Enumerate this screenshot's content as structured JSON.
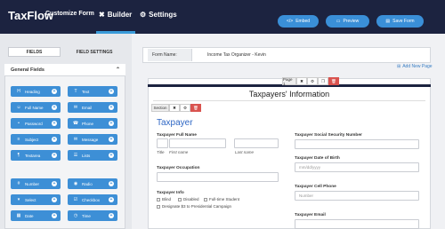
{
  "app": {
    "name": "TaxFlow",
    "subtitle": "Customize Form"
  },
  "nav": {
    "builder": "Builder",
    "settings": "Settings"
  },
  "actions": {
    "embed": "Embed",
    "preview": "Preview",
    "save": "Save Form"
  },
  "left_panel": {
    "tab_fields": "FIELDS",
    "tab_field_settings": "FIELD SETTINGS",
    "group_title": "General Fields",
    "fields": [
      {
        "label": "Heading",
        "icon": "heading-icon",
        "glyph": "H"
      },
      {
        "label": "Text",
        "icon": "text-icon",
        "glyph": "T"
      },
      {
        "label": "Full Name",
        "icon": "user-icon",
        "glyph": "☺"
      },
      {
        "label": "Email",
        "icon": "email-icon",
        "glyph": "✉"
      },
      {
        "label": "Password",
        "icon": "lock-icon",
        "glyph": "•"
      },
      {
        "label": "Phone",
        "icon": "phone-icon",
        "glyph": "☎"
      },
      {
        "label": "Subject",
        "icon": "subject-icon",
        "glyph": "≡"
      },
      {
        "label": "Message",
        "icon": "message-icon",
        "glyph": "✉"
      },
      {
        "label": "Textarea",
        "icon": "textarea-icon",
        "glyph": "¶"
      },
      {
        "label": "Lists",
        "icon": "list-icon",
        "glyph": "☰"
      },
      {
        "label": "Number",
        "icon": "number-icon",
        "glyph": "#"
      },
      {
        "label": "Radio",
        "icon": "radio-icon",
        "glyph": "◉"
      },
      {
        "label": "Select",
        "icon": "select-icon",
        "glyph": "▾"
      },
      {
        "label": "Checkbox",
        "icon": "checkbox-icon",
        "glyph": "☑"
      },
      {
        "label": "Date",
        "icon": "calendar-icon",
        "glyph": "▦"
      },
      {
        "label": "Time",
        "icon": "clock-icon",
        "glyph": "◷"
      }
    ]
  },
  "form": {
    "name_label": "Form Name:",
    "name_value": "Income Tax Organizer - Kevin",
    "add_page": "Add New Page",
    "page_tool_label": "Page 1",
    "title": "Taxpayers' Information",
    "section_tool_label": "Section",
    "section_heading": "Taxpayer",
    "fields": {
      "full_name": "Taxpayer Full Name",
      "title_sub": "Title",
      "first_name_sub": "First name",
      "last_name_sub": "Last name",
      "ssn": "Taxpayer Social Security Number",
      "dob": "Taxpayer Date of Birth",
      "dob_placeholder": "mm/dd/yyyy",
      "occupation": "Taxpayer Occupation",
      "cell_phone": "Taxpayer Cell Phone",
      "cell_placeholder": "Number",
      "info": "Taxpayer Info",
      "info_options": [
        "Blind",
        "Disabled",
        "Full-time Student",
        "Designate $3 to Presidential Campaign"
      ],
      "email": "Taxpayer Email"
    }
  }
}
